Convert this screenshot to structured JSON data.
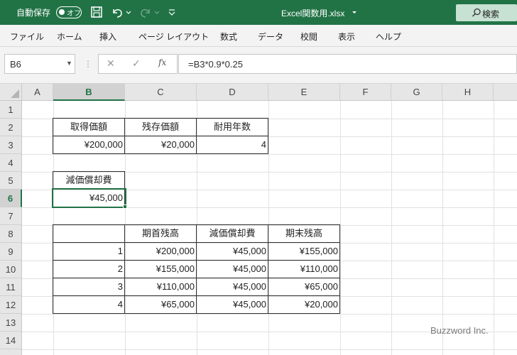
{
  "titlebar": {
    "autosave_label": "自動保存",
    "autosave_state": "オフ",
    "filename": "Excel関数用.xlsx",
    "search_label": "検索",
    "bg_color": "#217346"
  },
  "menu": [
    "ファイル",
    "ホーム",
    "挿入",
    "ページ レイアウト",
    "数式",
    "データ",
    "校閲",
    "表示",
    "ヘルプ"
  ],
  "formula_bar": {
    "name_box": "B6",
    "fx_label": "fx",
    "formula": "=B3*0.9*0.25"
  },
  "columns": [
    "A",
    "B",
    "C",
    "D",
    "E",
    "F",
    "G",
    "H"
  ],
  "rows": [
    "1",
    "2",
    "3",
    "4",
    "5",
    "6",
    "7",
    "8",
    "9",
    "10",
    "11",
    "12",
    "13",
    "14"
  ],
  "selected_cell": "B6",
  "cells": {
    "b2": "取得価額",
    "c2": "残存価額",
    "d2": "耐用年数",
    "b3": "¥200,000",
    "c3": "¥20,000",
    "d3": "4",
    "b5": "減価償却費",
    "b6": "¥45,000",
    "c8": "期首残高",
    "d8": "減価償却費",
    "e8": "期末残高",
    "b9": "1",
    "c9": "¥200,000",
    "d9": "¥45,000",
    "e9": "¥155,000",
    "b10": "2",
    "c10": "¥155,000",
    "d10": "¥45,000",
    "e10": "¥110,000",
    "b11": "3",
    "c11": "¥110,000",
    "d11": "¥45,000",
    "e11": "¥65,000",
    "b12": "4",
    "c12": "¥65,000",
    "d12": "¥45,000",
    "e12": "¥20,000"
  },
  "watermark": "Buzzword Inc."
}
